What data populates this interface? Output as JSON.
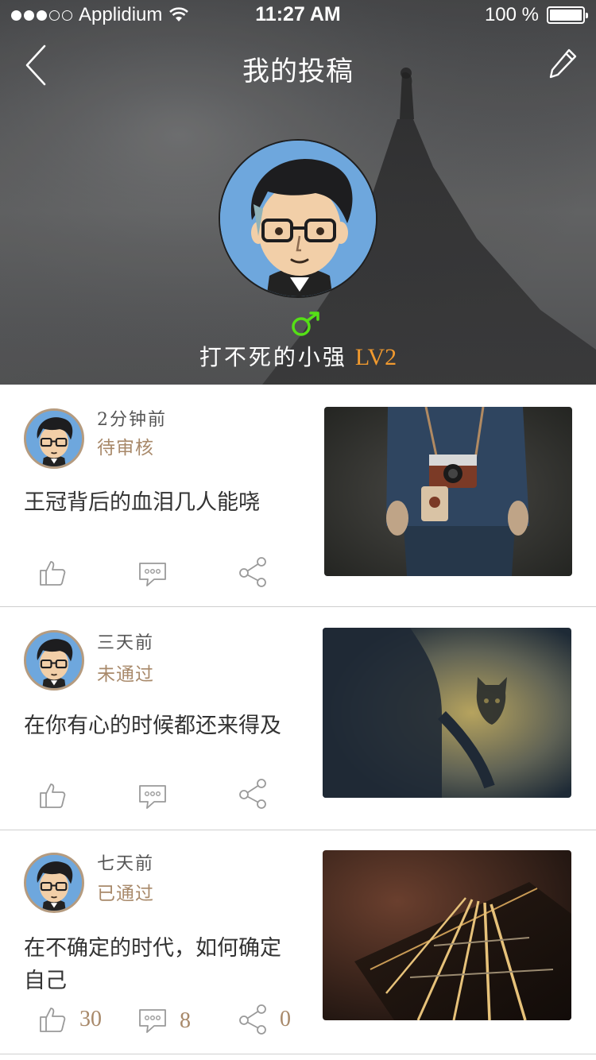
{
  "status_bar": {
    "carrier": "Applidium",
    "time": "11:27 AM",
    "battery": "100 %"
  },
  "nav": {
    "title": "我的投稿",
    "back_icon": "chevron-left-icon",
    "edit_icon": "pencil-icon"
  },
  "profile": {
    "gender_icon": "male-symbol-icon",
    "name": "打不死的小强",
    "level": "LV2"
  },
  "colors": {
    "accent_level": "#f29a2e",
    "gender": "#55e016",
    "status_text": "#a8896a"
  },
  "posts": [
    {
      "time": "2分钟前",
      "status": "待审核",
      "text": "王冠背后的血泪几人能哓",
      "image_icon": "camera-person-photo",
      "likes": "",
      "comments": "",
      "shares": ""
    },
    {
      "time": "三天前",
      "status": "未通过",
      "text": "在你有心的时候都还来得及",
      "image_icon": "shadow-figure-photo",
      "likes": "",
      "comments": "",
      "shares": ""
    },
    {
      "time": "七天前",
      "status": "已通过",
      "text": "在不确定的时代，如何确定自己",
      "image_icon": "guitar-strings-photo",
      "likes": "30",
      "comments": "8",
      "shares": "0"
    }
  ]
}
